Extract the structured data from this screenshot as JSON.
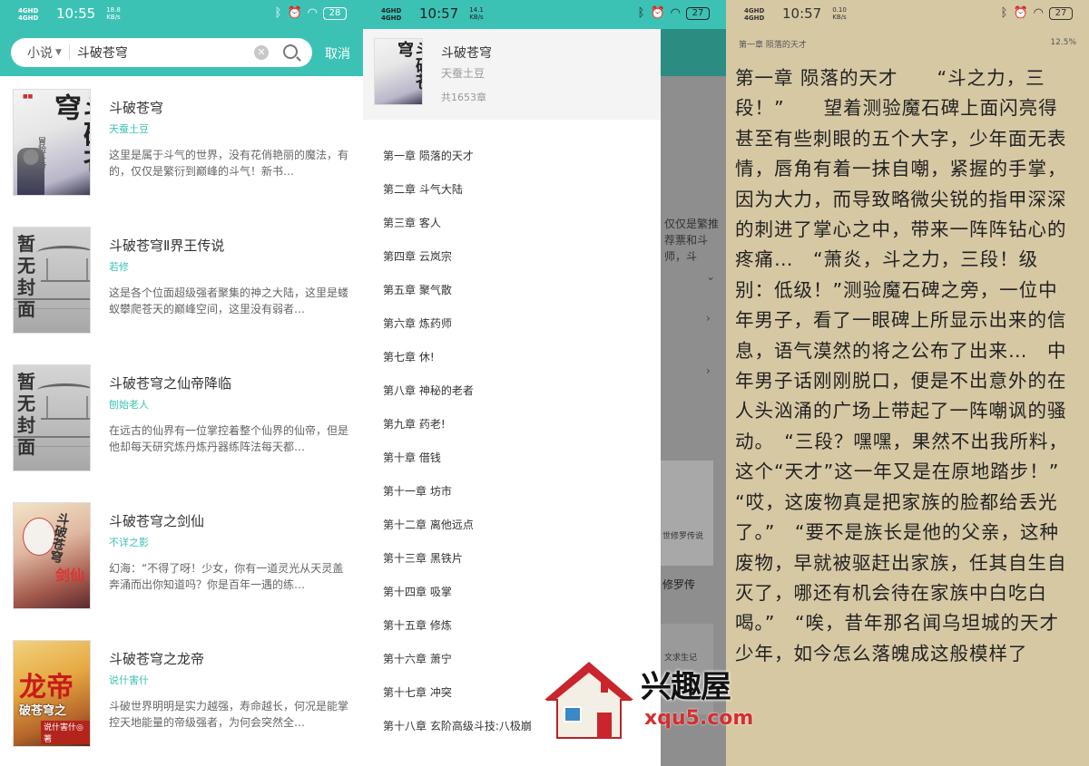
{
  "search_panel": {
    "status": {
      "net": "4GHD 4GHD",
      "time": "10:55",
      "speed": "18.8 KB/s",
      "battery": "28"
    },
    "category": "小说",
    "query": "斗破苍穹",
    "cancel_label": "取消",
    "results": [
      {
        "title": "斗破苍穹",
        "author": "天蚕土豆",
        "desc": "这里是属于斗气的世界，没有花俏艳丽的魔法，有的，仅仅是繁衍到巅峰的斗气！新书…",
        "cover_text": "斗破苍穹",
        "cover_sub": "冒险斗帝"
      },
      {
        "title": "斗破苍穹Ⅱ界王传说",
        "author": "若修",
        "desc": "这是各个位面超级强者聚集的神之大陆，这里是蝼蚁攀爬苍天的巅峰空间，这里没有弱者…",
        "cover_text": "暂无封面"
      },
      {
        "title": "斗破苍穹之仙帝降临",
        "author": "刨始老人",
        "desc": "在远古的仙界有一位掌控着整个仙界的仙帝，但是他却每天研究炼丹炼丹器练阵法每天都…",
        "cover_text": "暂无封面"
      },
      {
        "title": "斗破苍穹之剑仙",
        "author": "不详之影",
        "desc": "幻海：“不得了呀！少女，你有一道灵光从天灵盖奔涌而出你知道吗？你是百年一遇的练…",
        "cover_text": "斗破苍穹",
        "cover_sub": "剑仙"
      },
      {
        "title": "斗破苍穹之龙帝",
        "author": "说什害什",
        "desc": "斗破世界明明是实力越强，寿命越长，何况是能掌控天地能量的帝级强者，为何会突然全…",
        "cover_text": "龙帝",
        "cover_sub": "破苍穹之",
        "cover_by": "说什害什◎著"
      }
    ]
  },
  "toc_panel": {
    "status": {
      "net": "4GHD 4GHD",
      "time": "10:57",
      "speed": "14.1 KB/s",
      "battery": "27"
    },
    "book": {
      "title": "斗破苍穹",
      "author": "天蚕土豆",
      "count": "共1653章",
      "cover_text": "斗破苍穹"
    },
    "chapters": [
      "第一章 陨落的天才",
      "第二章 斗气大陆",
      "第三章 客人",
      "第四章 云岚宗",
      "第五章 聚气散",
      "第六章 炼药师",
      "第七章 休!",
      "第八章 神秘的老者",
      "第九章 药老!",
      "第十章 借钱",
      "第十一章 坊市",
      "第十二章 离他远点",
      "第十三章 黑铁片",
      "第十四章 吸掌",
      "第十五章 修炼",
      "第十六章 萧宁",
      "第十七章 冲突",
      "第十八章 玄阶高级斗技:八极崩"
    ],
    "background": {
      "text": "仅仅是繁推荐票和斗师，斗",
      "cover_text": "世修罗传说",
      "title": "修罗传",
      "cover2_text": "文求生记"
    }
  },
  "reader_panel": {
    "status": {
      "net": "4GHD 4GHD",
      "time": "10:57",
      "speed": "0.10 KB/s",
      "battery": "27"
    },
    "chapter_title": "第一章 陨落的天才",
    "progress": "12.5%",
    "content": "第一章 陨落的天才　　“斗之力，三段！”　　望着测验魔石碑上面闪亮得甚至有些刺眼的五个大字，少年面无表情，唇角有着一抹自嘲，紧握的手掌，因为大力，而导致略微尖锐的指甲深深的刺进了掌心之中，带来一阵阵钻心的疼痛…　“萧炎，斗之力，三段！级别：低级！”测验魔石碑之旁，一位中年男子，看了一眼碑上所显示出来的信息，语气漠然的将之公布了出来…　中年男子话刚刚脱口，便是不出意外的在人头汹涌的广场上带起了一阵嘲讽的骚动。　“三段？嘿嘿，果然不出我所料，这个“天才”这一年又是在原地踏步！”　　“哎，这废物真是把家族的脸都给丢光了。”　“要不是族长是他的父亲，这种废物，早就被驱赶出家族，任其自生自灭了，哪还有机会待在家族中白吃白喝。”　“唉，昔年那名闻乌坦城的天才少年，如今怎么落魄成这般模样了"
  },
  "watermark": {
    "text": "兴趣屋",
    "url": "xqu5.com"
  },
  "colors": {
    "accent": "#3cc2b5",
    "reader_bg": "#d7c8a4",
    "watermark_url": "#d62e2e"
  }
}
